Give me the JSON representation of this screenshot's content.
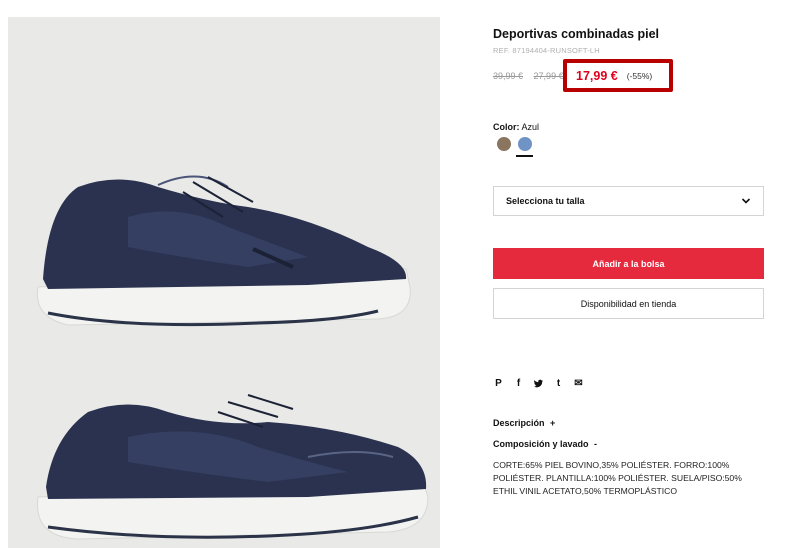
{
  "product": {
    "title": "Deportivas combinadas piel",
    "ref": "REF. 87194404-RUNSOFT-LH",
    "price_original": "39,99 €",
    "price_previous": "27,99 €",
    "price_current": "17,99 €",
    "discount": "(-55%)",
    "image_alt": "Navy blue combined leather sneakers"
  },
  "color": {
    "label": "Color:",
    "value": "Azul",
    "swatches": [
      {
        "name": "brown",
        "hex": "#8a7660"
      },
      {
        "name": "blue",
        "hex": "#6f93c4",
        "selected": true
      }
    ]
  },
  "size_select": {
    "label": "Selecciona tu talla",
    "icon": "chevron-down-icon"
  },
  "actions": {
    "add_to_bag": "Añadir a la bolsa",
    "store_availability": "Disponibilidad en tienda"
  },
  "share": {
    "icons": [
      "pinterest-icon",
      "facebook-icon",
      "twitter-icon",
      "tumblr-icon",
      "email-icon"
    ],
    "glyphs": [
      "P",
      "f",
      "t",
      "t",
      "✉"
    ]
  },
  "details": {
    "description_label": "Descripción",
    "description_toggle": "+",
    "composition_label": "Composición y lavado",
    "composition_toggle": "-",
    "composition_text": "CORTE:65% PIEL BOVINO,35% POLIÉSTER. FORRO:100% POLIÉSTER. PLANTILLA:100% POLIÉSTER. SUELA/PISO:50% ETHIL VINIL ACETATO,50% TERMOPLÁSTICO"
  },
  "colors": {
    "accent_red": "#e62a3e",
    "price_red": "#e0001b",
    "highlight_box": "#b80000"
  }
}
